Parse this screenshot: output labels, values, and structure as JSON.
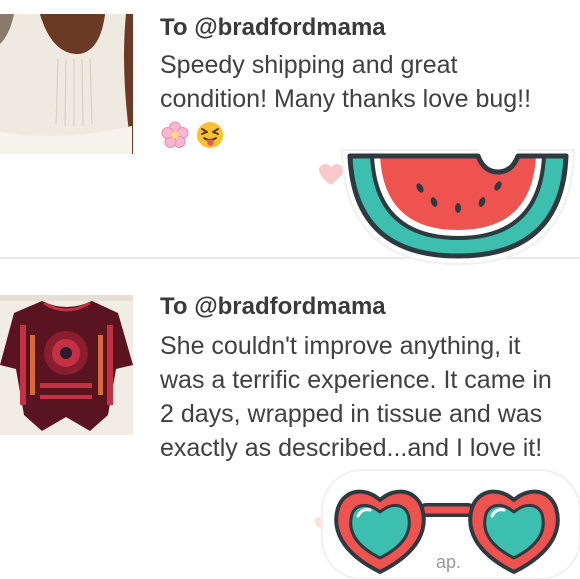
{
  "reviews": [
    {
      "to": "To @bradfordmama",
      "text": "Speedy shipping and great condition! Many thanks love bug!!",
      "emojis": [
        "cherry-blossom-icon",
        "tongue-squint-face-icon"
      ],
      "thumbnail": "white-pleated-top-photo"
    },
    {
      "to": "To @bradfordmama",
      "text": "She couldn't improve anything, it was a terrific experience. It came in 2 days, wrapped in tissue and was exactly as described...and I love it!",
      "thumbnail": "red-print-tunic-photo"
    }
  ],
  "decorations": {
    "sticker_1": "watermelon-slice-icon",
    "sticker_2": "heart-sunglasses-icon",
    "partial_text": "ap."
  },
  "colors": {
    "heart": "#f8c8cc",
    "watermelon_red": "#ef5350",
    "watermelon_rind": "#3cbfae",
    "outline": "#2d3a40",
    "glasses_frame": "#ef5350",
    "glasses_lens": "#3cbfae"
  }
}
